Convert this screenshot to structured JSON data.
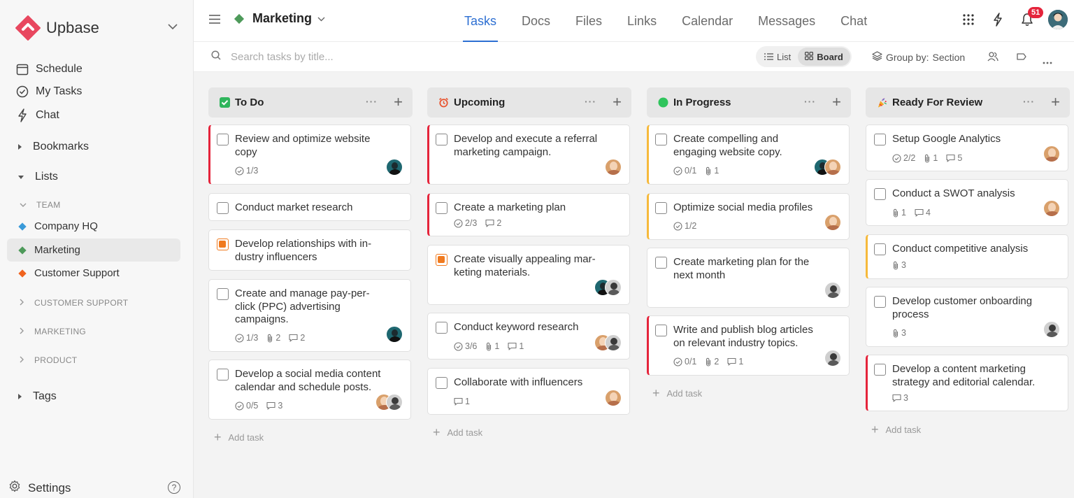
{
  "sidebar": {
    "brand": "Upbase",
    "nav": [
      {
        "label": "Schedule",
        "icon": "calendar-icon"
      },
      {
        "label": "My Tasks",
        "icon": "check-circle-icon"
      },
      {
        "label": "Chat",
        "icon": "lightning-icon"
      }
    ],
    "sections": {
      "bookmarks": "Bookmarks",
      "lists": "Lists",
      "tags": "Tags"
    },
    "team_head": "TEAM",
    "projects": [
      {
        "label": "Company HQ",
        "color": "#3a9ad9"
      },
      {
        "label": "Marketing",
        "color": "#4e9a5a"
      },
      {
        "label": "Customer Support",
        "color": "#f0631f"
      }
    ],
    "groups": [
      "CUSTOMER SUPPORT",
      "MARKETING",
      "PRODUCT"
    ],
    "settings": "Settings",
    "help": "?"
  },
  "topbar": {
    "project": "Marketing",
    "project_color": "#4e9a5a",
    "tabs": [
      "Tasks",
      "Docs",
      "Files",
      "Links",
      "Calendar",
      "Messages",
      "Chat"
    ],
    "active_tab": "Tasks",
    "notifications": "51"
  },
  "toolbar": {
    "search_placeholder": "Search tasks by title...",
    "list_label": "List",
    "board_label": "Board",
    "group_by_label": "Group by:",
    "group_by_value": "Section"
  },
  "board": {
    "add_task": "Add task",
    "columns": [
      {
        "title": "To Do",
        "cards": [
          {
            "title": "Review and optimize website copy",
            "checks": "1/3"
          },
          {
            "title": "Conduct market research"
          },
          {
            "title": "Develop relationships with in-dustry influencers"
          },
          {
            "title": "Create and manage pay-per-click (PPC) advertising campaigns.",
            "checks": "1/3",
            "attachments": "2",
            "comments": "2"
          },
          {
            "title": "Develop a social media content calendar and schedule posts.",
            "checks": "0/5",
            "comments": "3"
          }
        ]
      },
      {
        "title": "Upcoming",
        "cards": [
          {
            "title": "Develop and execute a referral marketing campaign."
          },
          {
            "title": "Create a marketing plan",
            "checks": "2/3",
            "comments": "2"
          },
          {
            "title": "Create visually appealing mar-keting materials."
          },
          {
            "title": "Conduct keyword research",
            "checks": "3/6",
            "attachments": "1",
            "comments": "1"
          },
          {
            "title": "Collaborate with influencers",
            "comments": "1"
          }
        ]
      },
      {
        "title": "In Progress",
        "cards": [
          {
            "title": "Create compelling and engaging website copy.",
            "checks": "0/1",
            "attachments": "1"
          },
          {
            "title": "Optimize social media profiles",
            "checks": "1/2"
          },
          {
            "title": "Create marketing plan for the next month"
          },
          {
            "title": "Write and publish blog articles on relevant industry topics.",
            "checks": "0/1",
            "attachments": "2",
            "comments": "1"
          }
        ]
      },
      {
        "title": "Ready For Review",
        "cards": [
          {
            "title": "Setup Google Analytics",
            "checks": "2/2",
            "attachments": "1",
            "comments": "5"
          },
          {
            "title": "Conduct a SWOT analysis",
            "attachments": "1",
            "comments": "4"
          },
          {
            "title": "Conduct competitive analysis",
            "attachments": "3"
          },
          {
            "title": "Develop customer onboarding process",
            "attachments": "3"
          },
          {
            "title": "Develop a content marketing strategy and editorial calendar.",
            "comments": "3"
          }
        ]
      }
    ]
  }
}
